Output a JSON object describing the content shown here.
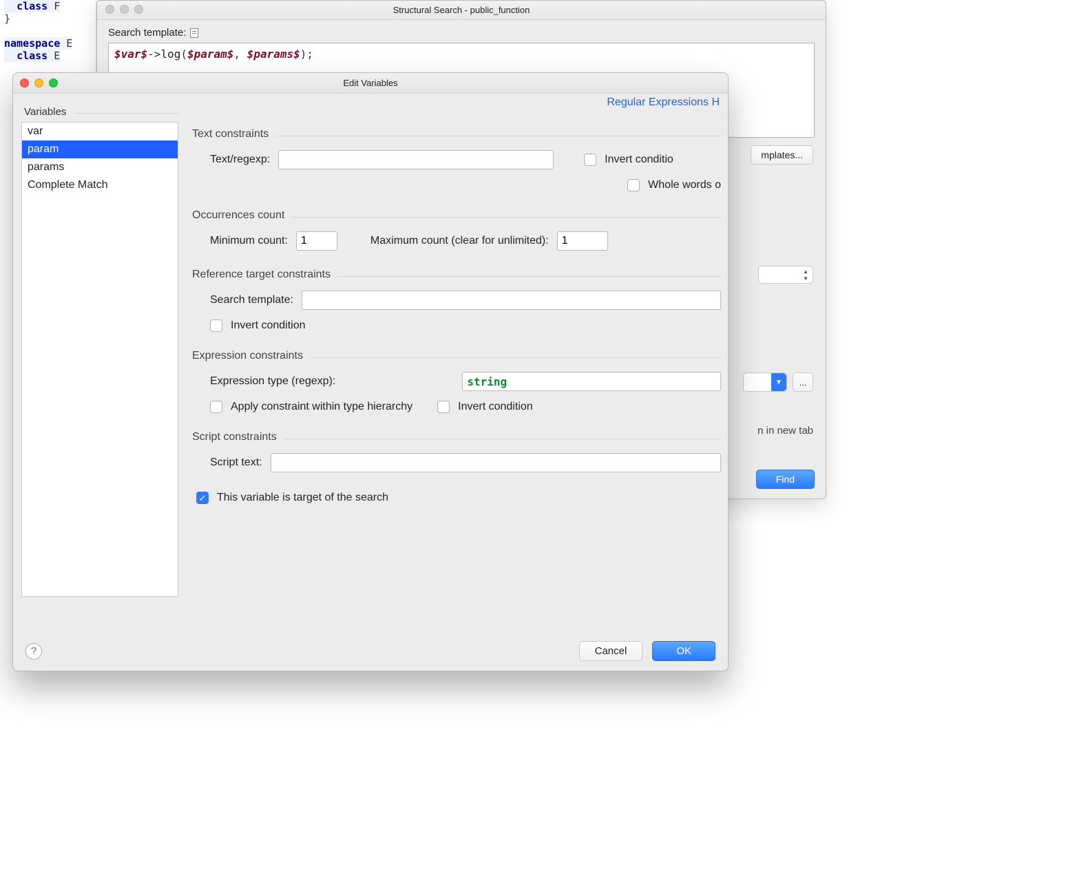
{
  "code_bg": {
    "line1_kw": "class",
    "line2": "}",
    "line3_kw": "namespace",
    "line4_kw": "class"
  },
  "ss": {
    "title": "Structural Search - public_function",
    "search_template_label": "Search template:",
    "template_tokens": {
      "var": "$var$",
      "arrow": "->",
      "log": "log",
      "open": "(",
      "param": "$param$",
      "comma": ", ",
      "params": "$params$",
      "close": ");"
    },
    "templates_button": "mplates...",
    "open_new_tab_hint": "n in new tab",
    "find_button": "Find",
    "dots": "..."
  },
  "ev": {
    "title": "Edit Variables",
    "regex_link": "Regular Expressions H",
    "variables_header": "Variables",
    "items": [
      "var",
      "param",
      "params",
      "Complete Match"
    ],
    "selected_index": 1,
    "sections": {
      "text": {
        "title": "Text constraints",
        "regexp_label": "Text/regexp:",
        "regexp_value": "",
        "invert_label": "Invert conditio",
        "whole_words_label": "Whole words o"
      },
      "occ": {
        "title": "Occurrences count",
        "min_label": "Minimum count:",
        "min_value": "1",
        "max_label": "Maximum count (clear for unlimited):",
        "max_value": "1"
      },
      "ref": {
        "title": "Reference target constraints",
        "search_template_label": "Search template:",
        "search_template_value": "",
        "invert_label": "Invert condition"
      },
      "expr": {
        "title": "Expression constraints",
        "type_label": "Expression type (regexp):",
        "type_value": "string",
        "hierarchy_label": "Apply constraint within type hierarchy",
        "invert_label": "Invert condition"
      },
      "script": {
        "title": "Script constraints",
        "text_label": "Script text:",
        "text_value": ""
      }
    },
    "target_checkbox_label": "This variable is target of the search",
    "target_checked": true,
    "cancel": "Cancel",
    "ok": "OK"
  }
}
